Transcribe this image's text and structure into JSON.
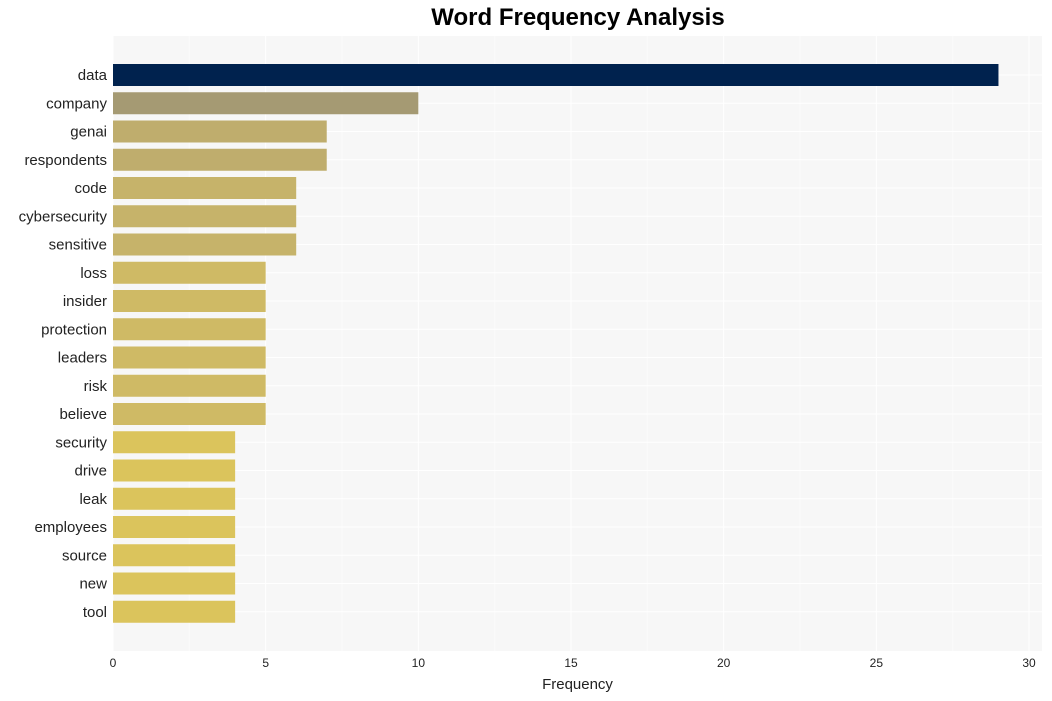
{
  "chart_data": {
    "type": "bar",
    "orientation": "horizontal",
    "title": "Word Frequency Analysis",
    "xlabel": "Frequency",
    "ylabel": "",
    "xlim": [
      0,
      30.4
    ],
    "xticks": [
      0,
      5,
      10,
      15,
      20,
      25,
      30
    ],
    "grid": true,
    "categories": [
      "data",
      "company",
      "genai",
      "respondents",
      "code",
      "cybersecurity",
      "sensitive",
      "loss",
      "insider",
      "protection",
      "leaders",
      "risk",
      "believe",
      "security",
      "drive",
      "leak",
      "employees",
      "source",
      "new",
      "tool"
    ],
    "values": [
      29,
      10,
      7,
      7,
      6,
      6,
      6,
      5,
      5,
      5,
      5,
      5,
      5,
      4,
      4,
      4,
      4,
      4,
      4,
      4
    ],
    "colors": [
      "#00224e",
      "#a59a73",
      "#bfad6d",
      "#bfad6d",
      "#c6b36a",
      "#c6b36a",
      "#c6b36a",
      "#cfba65",
      "#cfba65",
      "#cfba65",
      "#cfba65",
      "#cfba65",
      "#cfba65",
      "#dbc45c",
      "#dbc45c",
      "#dbc45c",
      "#dbc45c",
      "#dbc45c",
      "#dbc45c",
      "#dbc45c"
    ]
  }
}
